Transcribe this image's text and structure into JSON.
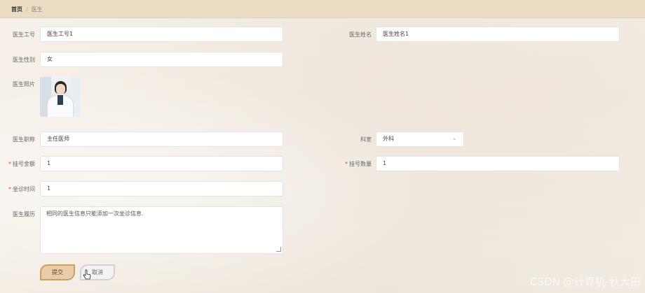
{
  "breadcrumb": {
    "home": "首页",
    "separator": "/",
    "current": "医生"
  },
  "form": {
    "doctor_id": {
      "label": "医生工号",
      "value": "医生工号1"
    },
    "doctor_name": {
      "label": "医生姓名",
      "value": "医生姓名1"
    },
    "gender": {
      "label": "医生性别",
      "value": "女"
    },
    "photo": {
      "label": "医生照片"
    },
    "title": {
      "label": "医生职称",
      "value": "主任医师"
    },
    "department": {
      "label": "科室",
      "value": "外科"
    },
    "fee": {
      "label": "挂号金额",
      "value": "1",
      "required": "*"
    },
    "quota": {
      "label": "挂号数量",
      "value": "1",
      "required": "*"
    },
    "clinic_time": {
      "label": "坐诊时间",
      "value": "1",
      "required": "*"
    },
    "resume": {
      "label": "医生履历",
      "value": "相同的医生信息只能添加一次坐诊信息."
    }
  },
  "buttons": {
    "submit": "提交",
    "cancel": "取消"
  },
  "watermark": "CSDN @计算机-秋大田",
  "colors": {
    "topbar": "#ecdcc4",
    "submit_bg": "#e8cda8",
    "submit_border": "#c8a063",
    "required": "#e5483a"
  }
}
